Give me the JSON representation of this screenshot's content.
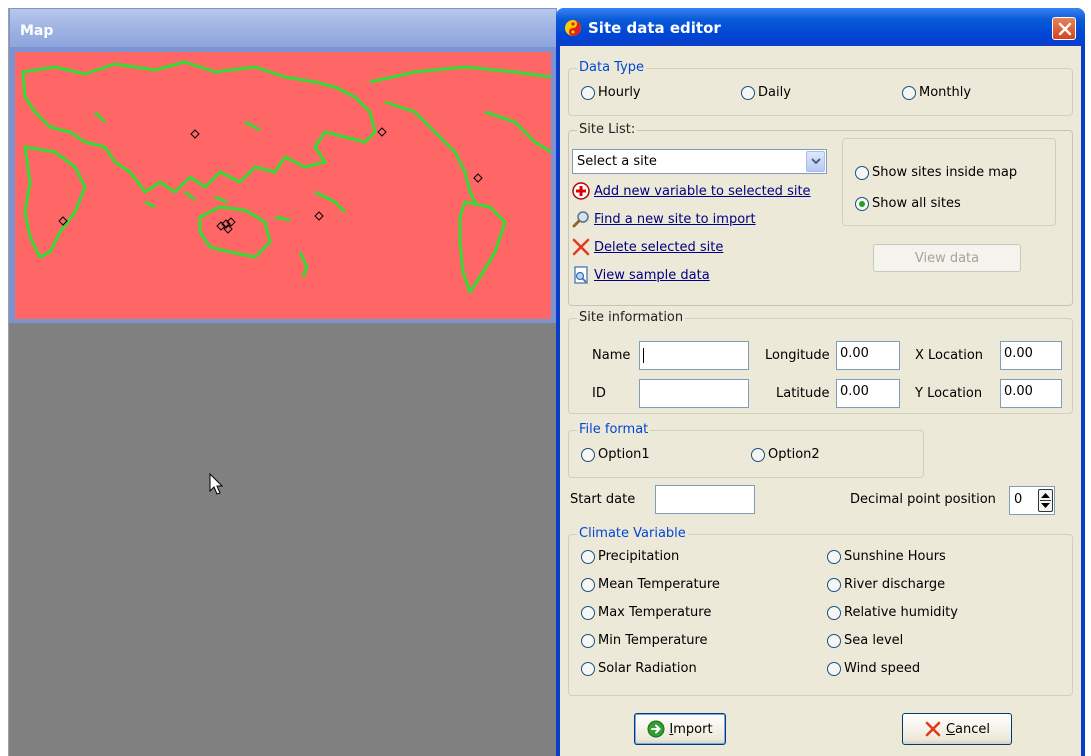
{
  "map_window": {
    "title": "Map"
  },
  "dialog": {
    "title": "Site data editor",
    "data_type": {
      "label": "Data Type",
      "options": [
        "Hourly",
        "Daily",
        "Monthly"
      ]
    },
    "site_list": {
      "label": "Site List:",
      "select_value": "Select a site",
      "actions": {
        "add_variable": "Add new variable to selected site",
        "find_site": "Find a new site to import",
        "delete_site": "Delete selected site",
        "view_sample": "View sample data"
      },
      "show_options": {
        "inside_map": "Show sites inside map",
        "all_sites": "Show all sites",
        "selected": "all_sites"
      },
      "view_data_button": "View data"
    },
    "site_information": {
      "label": "Site information",
      "name_label": "Name",
      "name_value": "",
      "id_label": "ID",
      "id_value": "",
      "longitude_label": "Longitude",
      "longitude_value": "0.00",
      "latitude_label": "Latitude",
      "latitude_value": "0.00",
      "x_location_label": "X Location",
      "x_location_value": "0.00",
      "y_location_label": "Y Location",
      "y_location_value": "0.00"
    },
    "file_format": {
      "label": "File format",
      "options": [
        "Option1",
        "Option2"
      ]
    },
    "start_date": {
      "label": "Start date",
      "value": ""
    },
    "decimal_point": {
      "label": "Decimal point position",
      "value": "0"
    },
    "climate_variable": {
      "label": "Climate Variable",
      "left": [
        "Precipitation",
        "Mean Temperature",
        "Max Temperature",
        "Min Temperature",
        "Solar Radiation"
      ],
      "right": [
        "Sunshine Hours",
        "River discharge",
        "Relative humidity",
        "Sea level",
        "Wind speed"
      ]
    },
    "buttons": {
      "import_rest": "mport",
      "import_mnemonic": "I",
      "cancel_rest": "ancel",
      "cancel_mnemonic": "C"
    }
  },
  "colors": {
    "map_ocean": "#ff6666",
    "map_land": "#33dd33",
    "titlebar_blue": "#0046d5",
    "dialog_face": "#ece9d8"
  }
}
